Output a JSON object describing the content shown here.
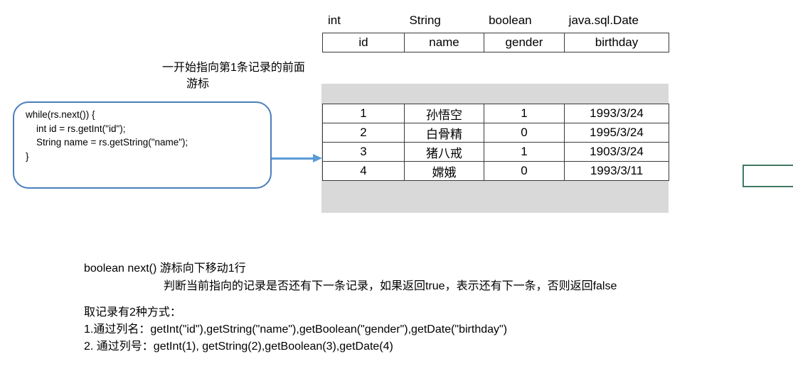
{
  "table": {
    "java_types": [
      "int",
      "String",
      "boolean",
      "java.sql.Date"
    ],
    "columns": [
      "id",
      "name",
      "gender",
      "birthday"
    ],
    "rows": [
      [
        "1",
        "孙悟空",
        "1",
        "1993/3/24"
      ],
      [
        "2",
        "白骨精",
        "0",
        "1995/3/24"
      ],
      [
        "3",
        "猪八戒",
        "1",
        "1903/3/24"
      ],
      [
        "4",
        "嫦娥",
        "0",
        "1993/3/11"
      ]
    ]
  },
  "annotations": {
    "cursor_position": "一开始指向第1条记录的前面",
    "cursor_label": "游标"
  },
  "code_box": {
    "code": "while(rs.next()) {\n    int id = rs.getInt(\"id\");\n    String name = rs.getString(\"name\");\n}"
  },
  "notes": [
    "boolean next() 游标向下移动1行",
    "判断当前指向的记录是否还有下一条记录，如果返回true，表示还有下一条，否则返回false",
    "取记录有2种方式：",
    "1.通过列名：getInt(\"id\"),getString(\"name\"),getBoolean(\"gender\"),getDate(\"birthday\")",
    "2. 通过列号：getInt(1), getString(2),getBoolean(3),getDate(4)"
  ],
  "colors": {
    "callout_border": "#4a7ebb",
    "arrow": "#5b9bd5",
    "band_background": "#d9d9d9",
    "table_border": "#3b3b3b",
    "green_box_border": "#3f7a5f"
  }
}
